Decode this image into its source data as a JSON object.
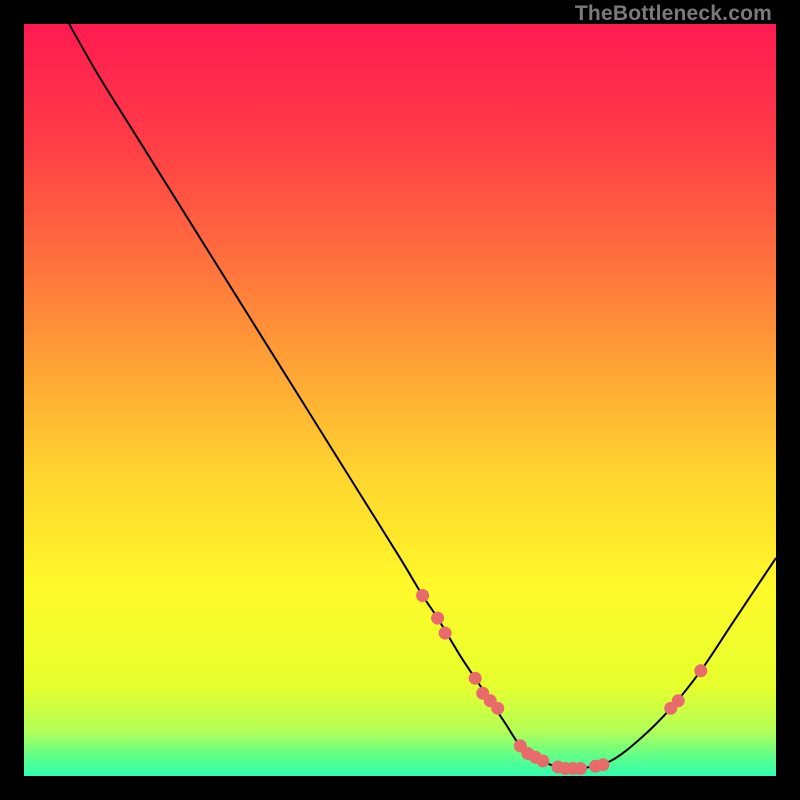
{
  "watermark": "TheBottleneck.com",
  "chart_data": {
    "type": "line",
    "title": "",
    "xlabel": "",
    "ylabel": "",
    "xlim": [
      0,
      100
    ],
    "ylim": [
      0,
      100
    ],
    "grid": false,
    "series": [
      {
        "name": "curve",
        "x": [
          6,
          10,
          15,
          20,
          25,
          30,
          35,
          40,
          45,
          50,
          53,
          55,
          58,
          60,
          62,
          64,
          66,
          68,
          70,
          72,
          74,
          78,
          82,
          86,
          90,
          94,
          98,
          100
        ],
        "y": [
          100,
          93,
          85,
          77,
          69,
          61,
          53,
          45,
          37,
          29,
          24,
          21,
          16,
          13,
          10,
          7,
          4,
          2.5,
          1.5,
          1,
          1,
          2,
          5,
          9,
          14,
          20,
          26,
          29
        ]
      }
    ],
    "scatter_points": {
      "name": "markers",
      "x": [
        53,
        55,
        56,
        60,
        61,
        62,
        63,
        66,
        67,
        68,
        69,
        71,
        72,
        73,
        74,
        76,
        77,
        86,
        87,
        90
      ],
      "y": [
        24,
        21,
        19,
        13,
        11,
        10,
        9,
        4,
        3,
        2.5,
        2,
        1.2,
        1,
        1,
        1,
        1.3,
        1.5,
        9,
        10,
        14
      ]
    },
    "gradient_stops": [
      {
        "offset": 0.0,
        "color": "#ff1a52"
      },
      {
        "offset": 0.15,
        "color": "#ff3b47"
      },
      {
        "offset": 0.3,
        "color": "#ff6b3e"
      },
      {
        "offset": 0.45,
        "color": "#ffa136"
      },
      {
        "offset": 0.6,
        "color": "#ffd52f"
      },
      {
        "offset": 0.75,
        "color": "#fff92a"
      },
      {
        "offset": 0.88,
        "color": "#e6ff2d"
      },
      {
        "offset": 0.94,
        "color": "#b3ff57"
      },
      {
        "offset": 0.975,
        "color": "#5cff8a"
      },
      {
        "offset": 1.0,
        "color": "#2fffb0"
      }
    ],
    "marker_color": "#e86a6a",
    "curve_color": "#000000"
  }
}
